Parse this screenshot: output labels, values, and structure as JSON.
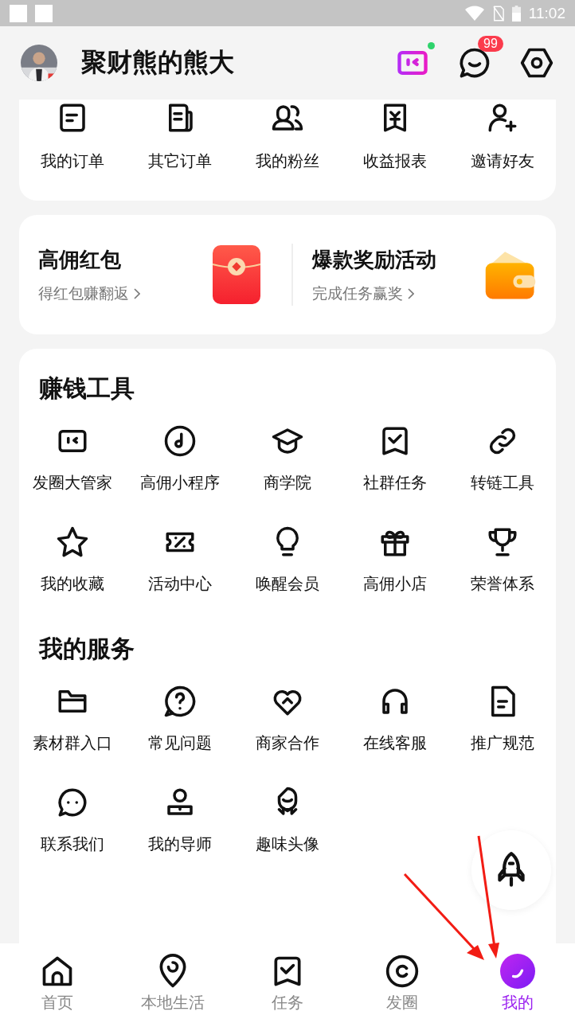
{
  "status_bar": {
    "time": "11:02"
  },
  "header": {
    "username": "聚财熊的熊大",
    "message_count": "99"
  },
  "orders": [
    "我的订单",
    "其它订单",
    "我的粉丝",
    "收益报表",
    "邀请好友"
  ],
  "promos": [
    {
      "title": "高佣红包",
      "subtitle": "得红包赚翻返"
    },
    {
      "title": "爆款奖励活动",
      "subtitle": "完成任务赢奖"
    }
  ],
  "sections": [
    {
      "title": "赚钱工具",
      "items": [
        "发圈大管家",
        "高佣小程序",
        "商学院",
        "社群任务",
        "转链工具",
        "我的收藏",
        "活动中心",
        "唤醒会员",
        "高佣小店",
        "荣誉体系"
      ]
    },
    {
      "title": "我的服务",
      "items": [
        "素材群入口",
        "常见问题",
        "商家合作",
        "在线客服",
        "推广规范",
        "联系我们",
        "我的导师",
        "趣味头像"
      ]
    }
  ],
  "nav": [
    {
      "label": "首页",
      "selected": false
    },
    {
      "label": "本地生活",
      "selected": false
    },
    {
      "label": "任务",
      "selected": false
    },
    {
      "label": "发圈",
      "selected": false
    },
    {
      "label": "我的",
      "selected": true
    }
  ]
}
